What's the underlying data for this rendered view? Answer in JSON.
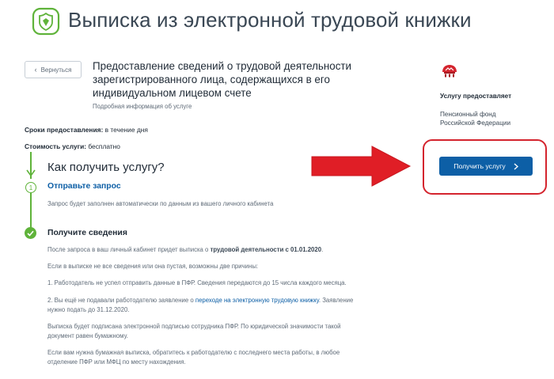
{
  "header": {
    "title": "Выписка из электронной трудовой книжки"
  },
  "back_button": {
    "label": "Вернуться"
  },
  "service": {
    "title_lines": [
      "Предоставление сведений о трудовой деятельности",
      "зарегистрированного лица, содержащихся в его",
      "индивидуальном лицевом счете"
    ],
    "details_link": "Подробная информация об услуге"
  },
  "meta": {
    "terms_label": "Сроки предоставления:",
    "terms_value": "в течение дня",
    "cost_label": "Стоимость услуги:",
    "cost_value": "бесплатно"
  },
  "how": {
    "title": "Как получить услугу?"
  },
  "step1": {
    "number": "1",
    "title": "Отправьте запрос",
    "description": "Запрос будет заполнен автоматически по данным из вашего личного кабинета"
  },
  "step2": {
    "title": "Получите сведения",
    "p1_text": "После запроса в ваш личный кабинет придет выписка о ",
    "p1_bold": "трудовой деятельности с 01.01.2020",
    "p1_end": ".",
    "p2": "Если в выписке не все сведения или она пустая, возможны две причины:",
    "p3": "1. Работодатель не успел отправить данные в ПФР. Сведения передаются до 15 числа каждого месяца.",
    "p4_a": "2. Вы ещё не подавали работодателю заявление о ",
    "p4_link": "переходе на электронную трудовую книжку",
    "p4_b": ". Заявление",
    "p4_c": "нужно подать до 31.12.2020.",
    "p5_a": "Выписка будет подписана электронной подписью сотрудника ПФР. По юридической значимости такой",
    "p5_b": "документ равен бумажному.",
    "p6_a": "Если вам нужна бумажная выписка, обратитесь к работодателю с последнего места работы, в любое",
    "p6_b": "отделение ПФР или МФЦ по месту нахождения."
  },
  "provider": {
    "label": "Услугу предоставляет",
    "name": "Пенсионный фонд Российской Федерации",
    "get_button": "Получить услугу"
  },
  "colors": {
    "accent_blue": "#0d5fa6",
    "step_green": "#5fb33a",
    "annotation_red": "#d4242e"
  },
  "icons": {
    "logo": "gosuslugi-emblem-icon",
    "back": "chevron-left-icon",
    "button_chevron": "chevron-right-icon",
    "provider_logo": "pfr-logo-icon",
    "step_done": "check-icon"
  }
}
